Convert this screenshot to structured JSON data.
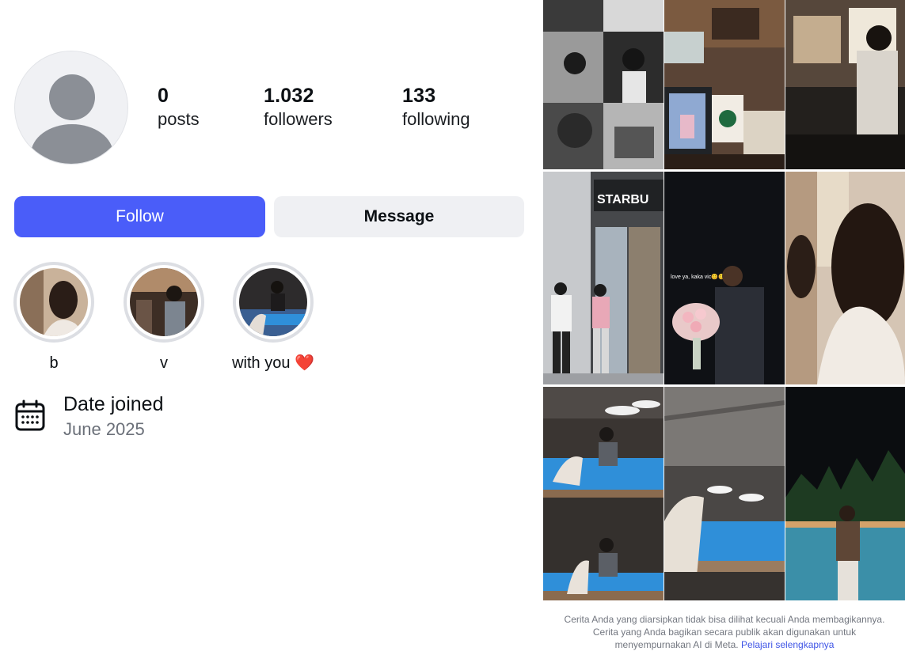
{
  "profile": {
    "stats": [
      {
        "value": "0",
        "label": "posts"
      },
      {
        "value": "1.032",
        "label": "followers"
      },
      {
        "value": "133",
        "label": "following"
      }
    ],
    "follow_label": "Follow",
    "message_label": "Message",
    "highlights": [
      {
        "label": "b"
      },
      {
        "label": "v"
      },
      {
        "label": "with you",
        "emoji": "❤️"
      }
    ],
    "date_joined_title": "Date joined",
    "date_joined_value": "June 2025"
  },
  "grid": {
    "photo_overlay_text": "love ya, kaka vic😊😊",
    "sign_text": "STARBU"
  },
  "footer": {
    "text": "Cerita Anda yang diarsipkan tidak bisa dilihat kecuali Anda membagikannya. Cerita yang Anda bagikan secara publik akan digunakan untuk menyempurnakan AI di Meta.",
    "link": "Pelajari selengkapnya"
  },
  "colors": {
    "accent": "#4a5df9",
    "secondary_button": "#eff0f3",
    "muted_text": "#6b7079",
    "link": "#3f55e6"
  }
}
